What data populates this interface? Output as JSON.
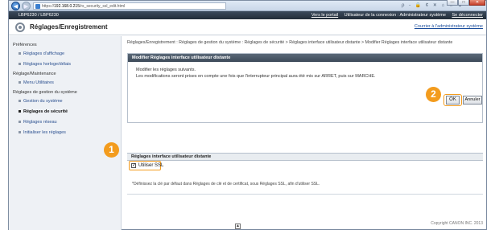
{
  "browser": {
    "url_prefix": "https://",
    "url_host": "192.168.0.215",
    "url_path": "/rs_security_ssl_edit.html",
    "tools": "ρ - 🔒 ¢ ✕   ⌂ ☆ ⚙",
    "win_min": "—",
    "win_max": "□",
    "win_close": "✕"
  },
  "topbar": {
    "model": "LBP6230 / LBP6230",
    "portal": "Vers le portail",
    "user_label": "Utilisateur de la connexion : Administrateur système",
    "logout": "Se déconnecter"
  },
  "page": {
    "title": "Réglages/Enregistrement",
    "mail_link": "Courrier à l'administrateur système"
  },
  "sidebar": {
    "sections": [
      {
        "label": "Préférences",
        "items": [
          {
            "label": "Réglages d'affichage",
            "active": false
          },
          {
            "label": "Réglages horloge/délais",
            "active": false
          }
        ]
      },
      {
        "label": "Réglage/Maintenance",
        "items": [
          {
            "label": "Menu Utilitaires",
            "active": false
          }
        ]
      },
      {
        "label": "Réglages de gestion du système",
        "items": [
          {
            "label": "Gestion du système",
            "active": false
          },
          {
            "label": "Réglages de sécurité",
            "active": true
          },
          {
            "label": "Réglages réseau",
            "active": false
          },
          {
            "label": "Initialiser les réglages",
            "active": false
          }
        ]
      }
    ]
  },
  "main": {
    "breadcrumb": "Réglages/Enregistrement : Réglages de gestion du système : Réglages de sécurité > Réglages interface utilisateur distante > Modifier Réglages interface utilisateur distante",
    "panel_title": "Modifier Réglages interface utilisateur distante",
    "instr1": "Modifier les réglages suivants.",
    "instr2": "Les modifications seront prises en compte une fois que l'interrupteur principal aura été mis sur ARRET, puis sur MARCHE.",
    "ok_label": "OK",
    "cancel_label": "Annuler",
    "section_title": "Réglages interface utilisateur distante",
    "checkbox_label": "Utiliser SSL",
    "checkbox_checked": true,
    "note": "*Définissez la clé par défaut dans Réglages de clé et de certificat, sous Réglages SSL, afin d'utiliser SSL.",
    "copyright": "Copyright CANON INC. 2013"
  },
  "badges": {
    "one": "1",
    "two": "2"
  }
}
